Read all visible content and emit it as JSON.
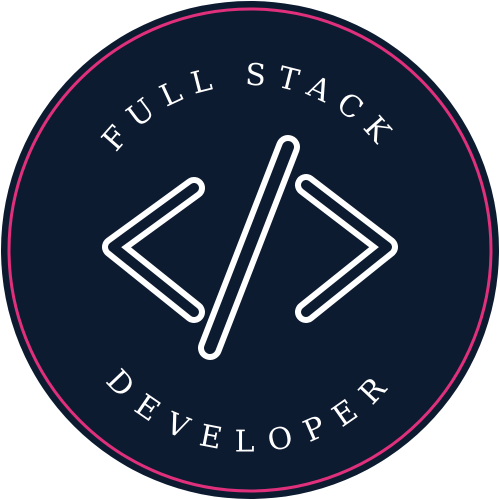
{
  "logo": {
    "top_text": "FULL STACK",
    "bottom_text": "DEVELOPER",
    "icon": "code-brackets-icon",
    "colors": {
      "background": "#0d1b31",
      "ring": "#e0307c",
      "foreground": "#ffffff"
    }
  }
}
